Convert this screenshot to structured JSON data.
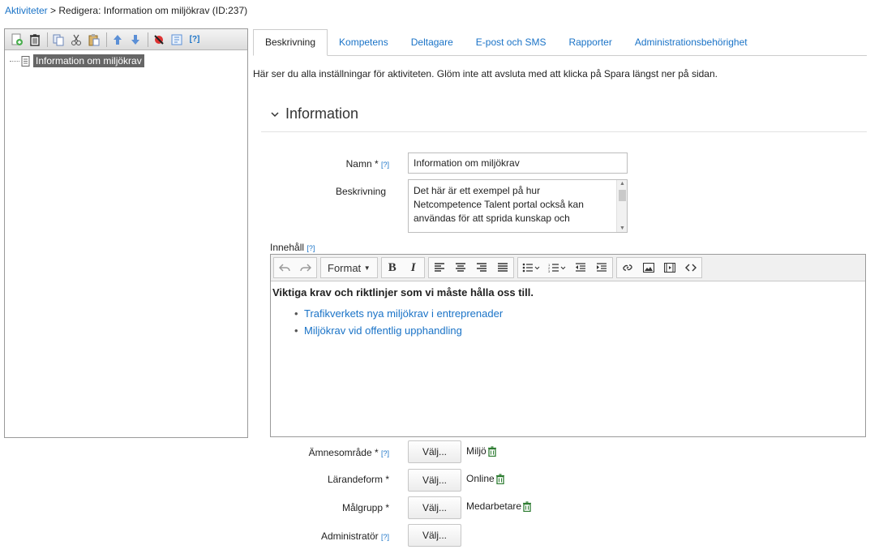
{
  "breadcrumb": {
    "root": "Aktiviteter",
    "separator": " > ",
    "current": "Redigera: Information om miljökrav (ID:237)"
  },
  "toolbar": {
    "help": "[?]"
  },
  "tree": {
    "item": "Information om miljökrav"
  },
  "tabs": [
    "Beskrivning",
    "Kompetens",
    "Deltagare",
    "E-post och SMS",
    "Rapporter",
    "Administrationsbehörighet"
  ],
  "intro": "Här ser du alla inställningar för aktiviteten. Glöm inte att avsluta med att klicka på Spara längst ner på sidan.",
  "section": {
    "title": "Information"
  },
  "form": {
    "help": "[?]",
    "name_label": "Namn *",
    "name_value": "Information om miljökrav",
    "desc_label": "Beskrivning",
    "desc_value": "Det här är ett exempel på hur Netcompetence Talent portal också kan användas för att sprida kunskap och",
    "content_label": "Innehåll",
    "select_label": "Välj...",
    "subject_label": "Ämnesområde *",
    "subject_value": "Miljö",
    "learning_label": "Lärandeform *",
    "learning_value": "Online",
    "target_label": "Målgrupp *",
    "target_value": "Medarbetare",
    "admin_label": "Administratör"
  },
  "editor": {
    "format": "Format",
    "heading": "Viktiga krav och riktlinjer som vi måste hålla oss till.",
    "links": [
      "Trafikverkets nya miljökrav i entreprenader",
      "Miljökrav vid offentlig upphandling"
    ]
  }
}
